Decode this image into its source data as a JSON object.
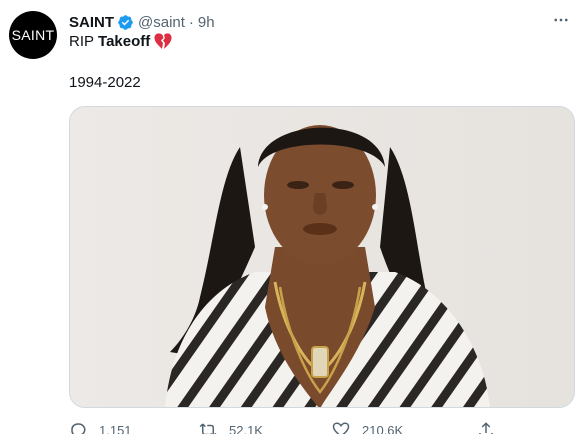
{
  "tweet": {
    "avatar_text": "SAINT",
    "display_name": "SAINT",
    "handle": "@saint",
    "separator": "·",
    "time": "9h",
    "text_prefix": "RIP",
    "text_name": "Takeoff",
    "years": "1994-2022"
  },
  "actions": {
    "replies": "1,151",
    "retweets": "52.1K",
    "likes": "210.6K"
  },
  "colors": {
    "verified": "#1d9bf0",
    "heart": "#f91880",
    "secondary_text": "#536471"
  }
}
